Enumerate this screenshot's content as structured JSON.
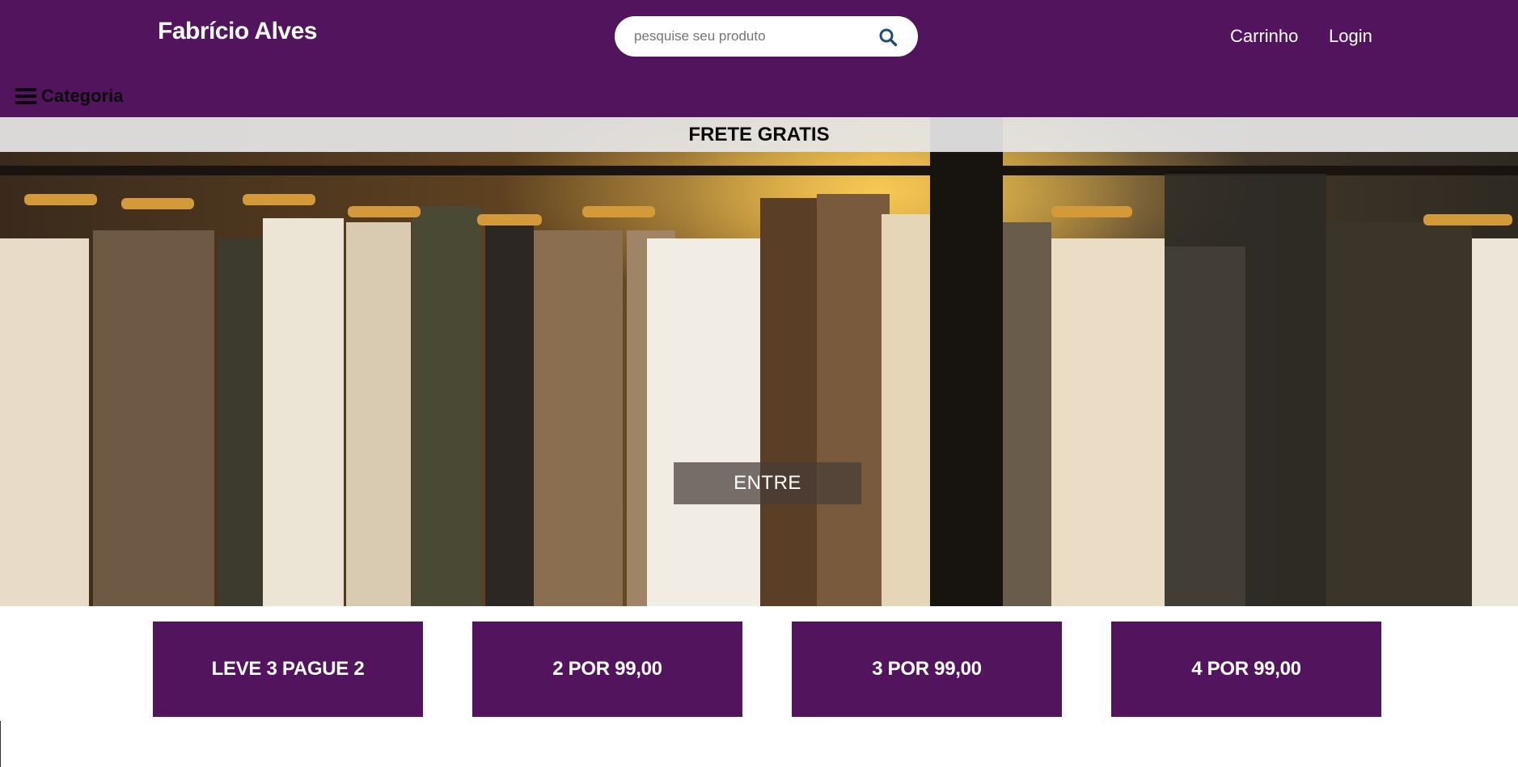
{
  "header": {
    "brand": "Fabrício Alves",
    "search": {
      "placeholder": "pesquise seu produto",
      "value": ""
    },
    "nav": {
      "cart": "Carrinho",
      "login": "Login"
    },
    "category_label": "Categoria"
  },
  "hero": {
    "promo_banner": "FRETE GRATIS",
    "enter_button": "ENTRE"
  },
  "offers": [
    {
      "label": "LEVE 3 PAGUE 2"
    },
    {
      "label": "2 POR 99,00"
    },
    {
      "label": "3 POR 99,00"
    },
    {
      "label": "4 POR 99,00"
    }
  ],
  "colors": {
    "brand_purple": "#52145c",
    "banner_gray": "#e6e6e6",
    "text_dark": "#0b0b0b"
  },
  "icons": {
    "search": "search-icon",
    "menu": "hamburger-menu-icon"
  }
}
